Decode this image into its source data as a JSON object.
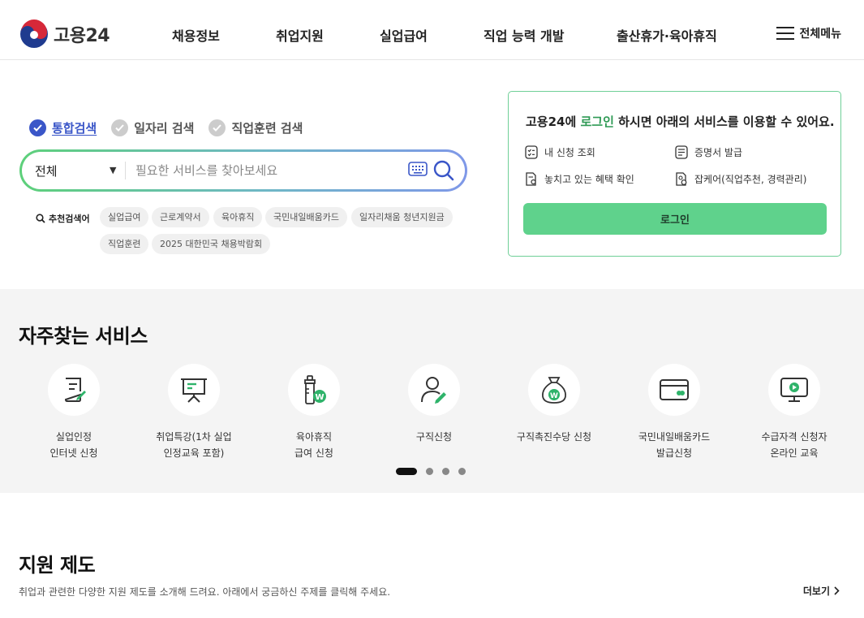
{
  "header": {
    "logo_text": "고용24",
    "nav": [
      "채용정보",
      "취업지원",
      "실업급여",
      "직업 능력 개발",
      "출산휴가·육아휴직"
    ],
    "menu_label": "전체메뉴"
  },
  "search": {
    "tabs": [
      {
        "label": "통합검색",
        "active": true
      },
      {
        "label": "일자리 검색",
        "active": false
      },
      {
        "label": "직업훈련 검색",
        "active": false
      }
    ],
    "scope_value": "전체",
    "placeholder": "필요한 서비스를 찾아보세요",
    "recommend_label": "추천검색어",
    "keywords": [
      "실업급여",
      "근로계약서",
      "육아휴직",
      "국민내일배움카드",
      "일자리채움 청년지원금",
      "직업훈련",
      "2025 대한민국 채용박람회"
    ]
  },
  "login_card": {
    "msg_prefix": "고용24에 ",
    "msg_highlight": "로그인",
    "msg_suffix": " 하시면 아래의 서비스를 이용할 수 있어요.",
    "services": [
      "내 신청 조회",
      "증명서 발급",
      "놓치고 있는 혜택 확인",
      "잡케어(직업추천, 경력관리)"
    ],
    "button_label": "로그인"
  },
  "frequent": {
    "title": "자주찾는 서비스",
    "items": [
      {
        "label": "실업인정\n인터넷 신청",
        "icon": "document-edit-icon"
      },
      {
        "label": "취업특강(1차 실업\n인정교육 포함)",
        "icon": "presentation-board-icon"
      },
      {
        "label": "육아휴직\n급여 신청",
        "icon": "baby-bottle-won-icon"
      },
      {
        "label": "구직신청",
        "icon": "person-edit-icon"
      },
      {
        "label": "구직촉진수당 신청",
        "icon": "money-bag-won-icon"
      },
      {
        "label": "국민내일배움카드\n발급신청",
        "icon": "card-icon"
      },
      {
        "label": "수급자격 신청자\n온라인 교육",
        "icon": "monitor-play-icon"
      }
    ],
    "pagination": {
      "current": 1,
      "total": 4
    }
  },
  "support": {
    "title": "지원 제도",
    "description": "취업과 관련한 다양한 지원 제도를 소개해 드려요. 아래에서 궁금하신 주제를 클릭해 주세요.",
    "more_label": "더보기"
  },
  "colors": {
    "accent_green": "#5fd28c",
    "accent_blue": "#3a56c8",
    "highlight_green": "#2f9a55"
  }
}
